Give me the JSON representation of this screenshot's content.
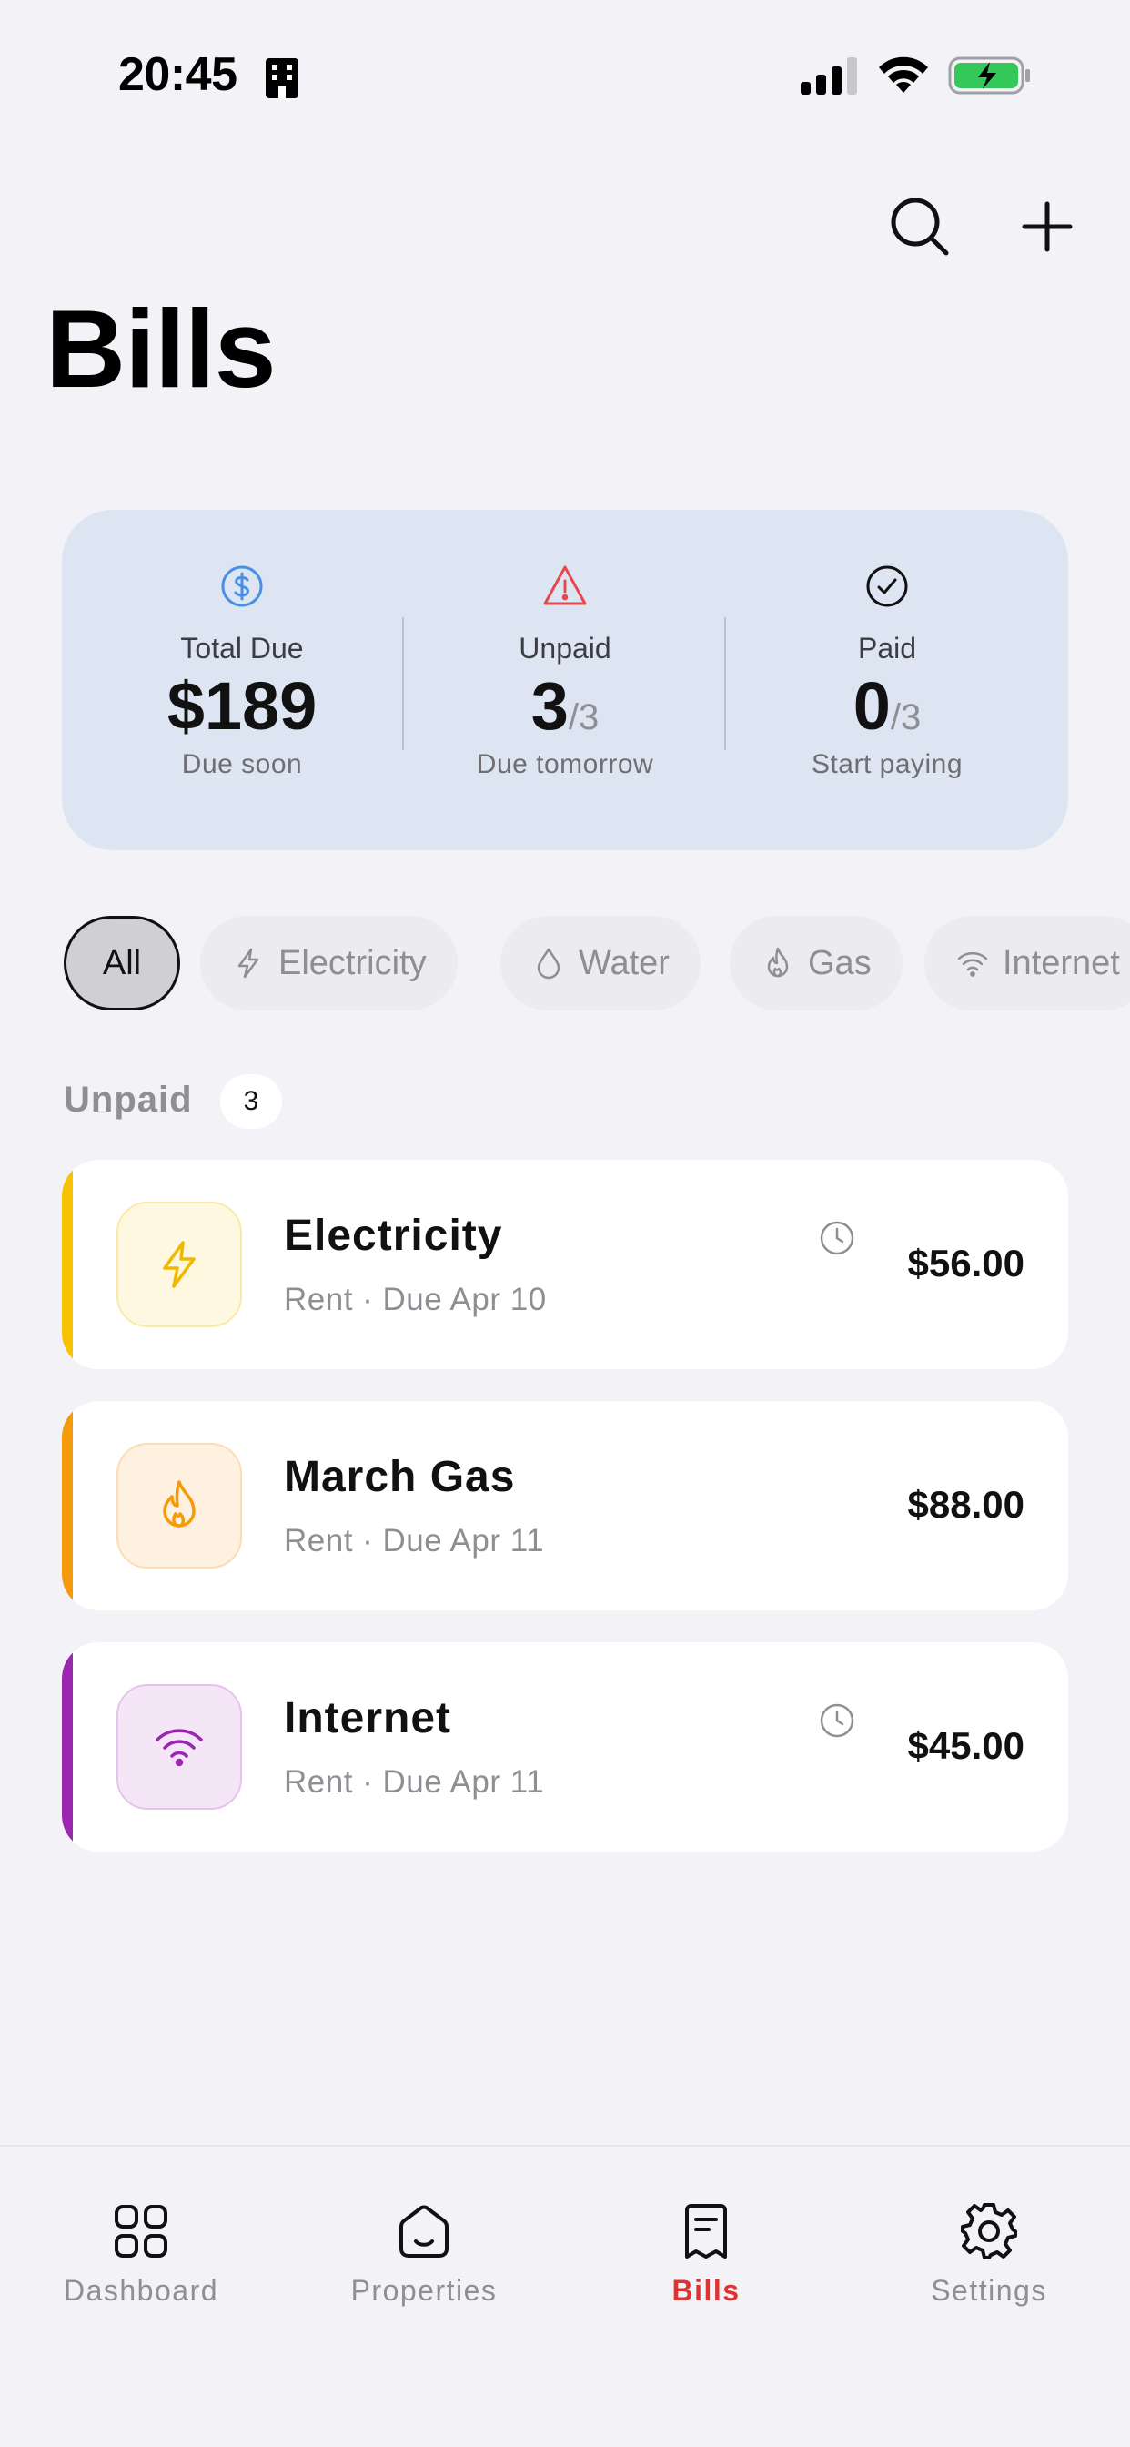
{
  "status_bar": {
    "time": "20:45"
  },
  "header": {
    "title": "Bills"
  },
  "summary": {
    "total_due": {
      "label": "Total Due",
      "value": "$189",
      "caption": "Due soon"
    },
    "unpaid": {
      "label": "Unpaid",
      "value": "3",
      "of": "/3",
      "caption": "Due tomorrow"
    },
    "paid": {
      "label": "Paid",
      "value": "0",
      "of": "/3",
      "caption": "Start paying"
    }
  },
  "filters": [
    {
      "label": "All",
      "active": true
    },
    {
      "label": "Electricity",
      "icon": "bolt-icon"
    },
    {
      "label": "Water",
      "icon": "drop-icon"
    },
    {
      "label": "Gas",
      "icon": "flame-icon"
    },
    {
      "label": "Internet",
      "icon": "wifi-icon"
    }
  ],
  "section": {
    "label": "Unpaid",
    "count": "3"
  },
  "bills": [
    {
      "name": "Electricity",
      "subtitle": "Rent · Due Apr 10",
      "amount": "$56.00",
      "icon": "bolt-icon",
      "accent": "#f7c300",
      "icon_bg": "#fff8e0",
      "has_clock": true
    },
    {
      "name": "March Gas",
      "subtitle": "Rent · Due Apr 11",
      "amount": "$88.00",
      "icon": "flame-icon",
      "accent": "#f59a0a",
      "icon_bg": "#fff1e0",
      "has_clock": false
    },
    {
      "name": "Internet",
      "subtitle": "Rent · Due Apr 11",
      "amount": "$45.00",
      "icon": "wifi-icon",
      "accent": "#9b27b0",
      "icon_bg": "#f5e6f7",
      "has_clock": true
    }
  ],
  "tabs": [
    {
      "label": "Dashboard",
      "icon": "grid-icon"
    },
    {
      "label": "Properties",
      "icon": "home-icon"
    },
    {
      "label": "Bills",
      "icon": "receipt-icon",
      "active": true
    },
    {
      "label": "Settings",
      "icon": "gear-icon"
    }
  ],
  "colors": {
    "accent": "#e0322f",
    "summary_bg": "#dde5f2",
    "page_bg": "#f2f2f7"
  }
}
